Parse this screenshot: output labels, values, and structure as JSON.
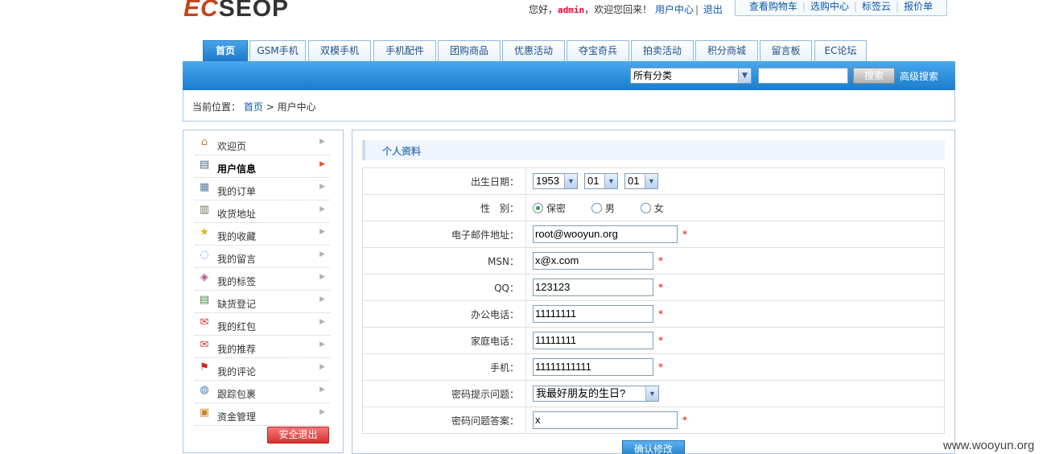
{
  "logo": {
    "ec": "EC",
    "rest": "SEOP"
  },
  "top": {
    "greeting_prefix": "您好，",
    "username": "admin",
    "greeting_suffix": "，欢迎您回来！",
    "user_center": "用户中心",
    "logout": "退出",
    "sep": "|"
  },
  "topbox": {
    "links": [
      "查看购物车",
      "选购中心",
      "标签云",
      "报价单"
    ]
  },
  "nav": {
    "tabs": [
      "首页",
      "GSM手机",
      "双模手机",
      "手机配件",
      "团购商品",
      "优惠活动",
      "夺宝奇兵",
      "拍卖活动",
      "积分商城",
      "留言板",
      "EC论坛"
    ],
    "active_index": 0
  },
  "search": {
    "category_selected": "所有分类",
    "keyword": "",
    "button": "搜索",
    "advanced": "高级搜索"
  },
  "breadcrumb": {
    "prefix": "当前位置：",
    "home": "首页",
    "separator": ">",
    "current": "用户中心"
  },
  "sidebar": {
    "items": [
      {
        "label": "欢迎页",
        "icon": "home-icon",
        "glyph": "⌂"
      },
      {
        "label": "用户信息",
        "icon": "user-card-icon",
        "glyph": "▤",
        "active": true
      },
      {
        "label": "我的订单",
        "icon": "order-document-icon",
        "glyph": "▦"
      },
      {
        "label": "收货地址",
        "icon": "address-book-icon",
        "glyph": "▥"
      },
      {
        "label": "我的收藏",
        "icon": "star-icon",
        "glyph": "★"
      },
      {
        "label": "我的留言",
        "icon": "speech-bubble-icon",
        "glyph": "◌"
      },
      {
        "label": "我的标签",
        "icon": "tag-icon",
        "glyph": "◈"
      },
      {
        "label": "缺货登记",
        "icon": "clipboard-icon",
        "glyph": "▤"
      },
      {
        "label": "我的红包",
        "icon": "red-packet-icon",
        "glyph": "✉"
      },
      {
        "label": "我的推荐",
        "icon": "recommend-icon",
        "glyph": "✉"
      },
      {
        "label": "我的评论",
        "icon": "flag-icon",
        "glyph": "⚑"
      },
      {
        "label": "跟踪包裹",
        "icon": "package-track-icon",
        "glyph": "◍"
      },
      {
        "label": "资金管理",
        "icon": "wallet-icon",
        "glyph": "▣"
      }
    ],
    "logout_button": "安全退出"
  },
  "section": {
    "title": "个人资料"
  },
  "form": {
    "birthday": {
      "label": "出生日期：",
      "year": "1953",
      "month": "01",
      "day": "01"
    },
    "gender": {
      "label": "性　别：",
      "options": [
        "保密",
        "男",
        "女"
      ],
      "selected": "保密"
    },
    "email": {
      "label": "电子邮件地址：",
      "value": "root@wooyun.org"
    },
    "msn": {
      "label": "MSN：",
      "value": "x@x.com"
    },
    "qq": {
      "label": "QQ：",
      "value": "123123"
    },
    "office_phone": {
      "label": "办公电话：",
      "value": "11111111"
    },
    "home_phone": {
      "label": "家庭电话：",
      "value": "11111111"
    },
    "mobile": {
      "label": "手机：",
      "value": "11111111111"
    },
    "question": {
      "label": "密码提示问题：",
      "value": "我最好朋友的生日?"
    },
    "answer": {
      "label": "密码问题答案：",
      "value": "x"
    },
    "required_mark": "*",
    "submit": "确认修改"
  },
  "watermark": "www.wooyun.org",
  "colors": {
    "nav_blue": "#1e78c8",
    "link_blue": "#0a58a8",
    "required_red": "#ee0000",
    "logout_red": "#d73030"
  }
}
